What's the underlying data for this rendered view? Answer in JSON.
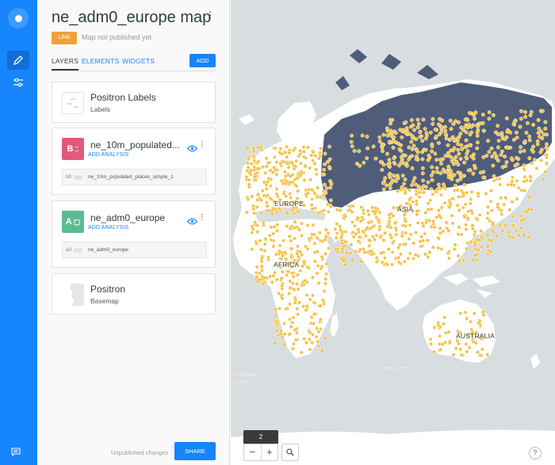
{
  "map_title": "ne_adm0_europe map",
  "publish_badge": "LINK",
  "publish_status": "Map not published yet",
  "tabs": [
    {
      "label": "LAYERS",
      "active": true
    },
    {
      "label": "ELEMENTS",
      "active": false
    },
    {
      "label": "WIDGETS",
      "active": false
    }
  ],
  "add_label": "ADD",
  "layers": [
    {
      "name": "Positron Labels",
      "subtitle": "Labels"
    },
    {
      "letter": "B",
      "name": "ne_10m_populated...",
      "analysis": "ADD ANALYSIS",
      "node_id": "b0",
      "node_source": "ne_10m_populated_places_simple_1",
      "color": "#e05a7a"
    },
    {
      "letter": "A",
      "name": "ne_adm0_europe",
      "analysis": "ADD ANALYSIS",
      "node_id": "a0",
      "node_source": "ne_adm0_europe",
      "color": "#5cba94"
    },
    {
      "name": "Positron",
      "subtitle": "Basemap"
    }
  ],
  "footer_status": "Unpublished changes",
  "share_label": "SHARE",
  "map": {
    "labels": [
      "EUROPE",
      "ASIA",
      "AFRICA",
      "AUSTRALIA"
    ],
    "oceans": [
      "Indian Ocean",
      "th Atlantic\nOcean"
    ],
    "zoom": "2",
    "zoom_out": "−",
    "zoom_in": "+",
    "help": "?",
    "colors": {
      "land": "#ffffff",
      "water": "#d8dde0",
      "europe_fill": "#4f5d7a",
      "points": "#f5c242"
    }
  }
}
